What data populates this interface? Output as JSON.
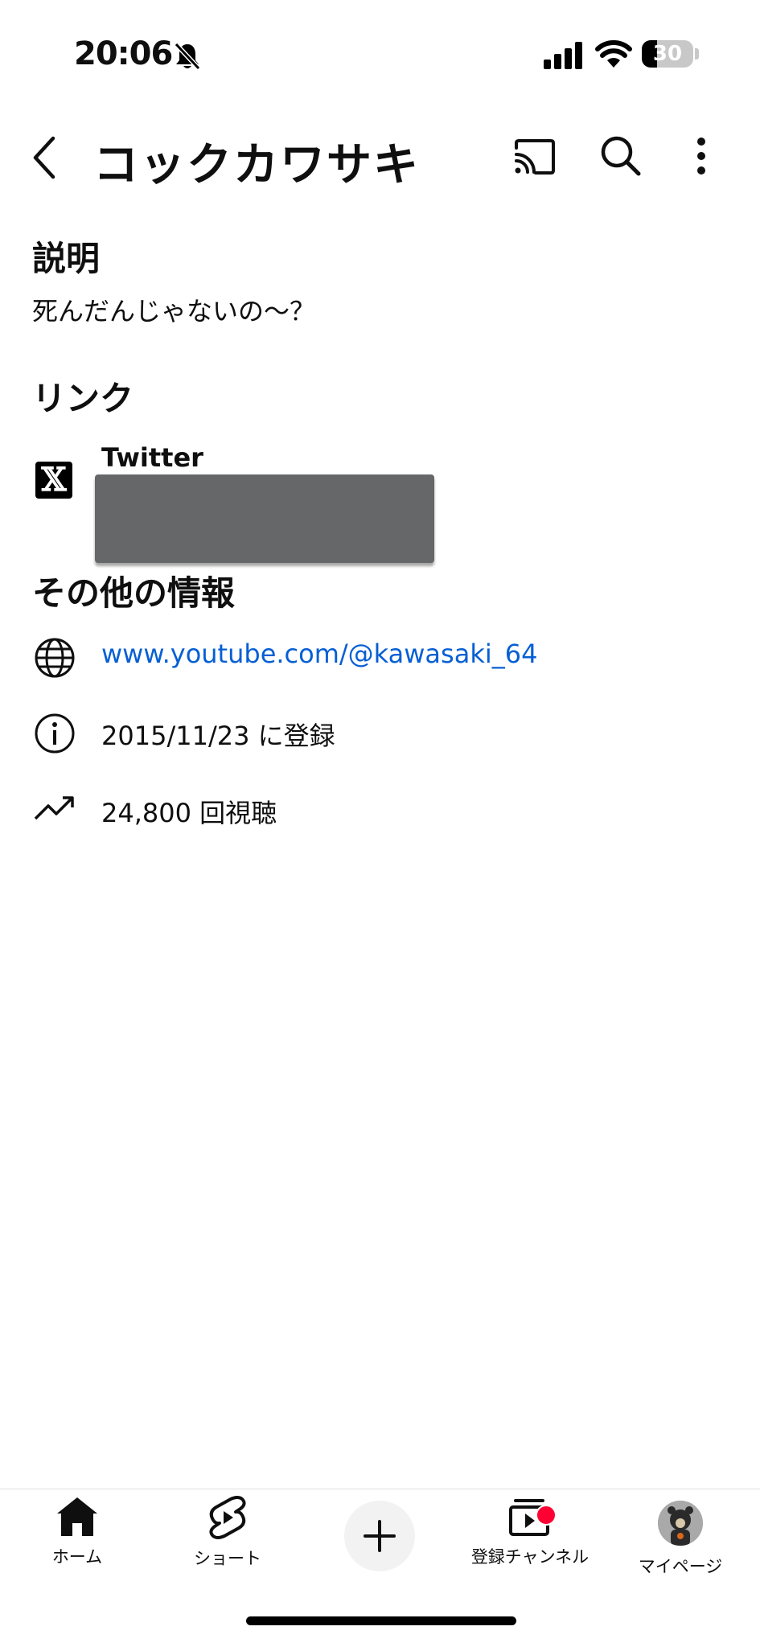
{
  "status_bar": {
    "time": "20:06",
    "battery": "30"
  },
  "header": {
    "title": "コックカワサキ"
  },
  "description": {
    "heading": "説明",
    "text": "死んだんじゃないの〜？"
  },
  "links": {
    "heading": "リンク",
    "items": [
      {
        "label": "Twitter",
        "icon": "x-logo-icon"
      }
    ]
  },
  "other_info": {
    "heading": "その他の情報",
    "url": "www.youtube.com/@kawasaki_64",
    "joined": "2015/11/23 に登録",
    "views": "24,800 回視聴"
  },
  "bottom_nav": {
    "items": [
      {
        "label": "ホーム",
        "icon": "home-icon"
      },
      {
        "label": "ショート",
        "icon": "shorts-icon"
      },
      {
        "label": "",
        "icon": "plus-icon"
      },
      {
        "label": "登録チャンネル",
        "icon": "subscriptions-icon"
      },
      {
        "label": "マイページ",
        "icon": "avatar"
      }
    ]
  },
  "colors": {
    "link": "#065fd4",
    "badge": "#ff0033",
    "text": "#0f0f0f"
  }
}
